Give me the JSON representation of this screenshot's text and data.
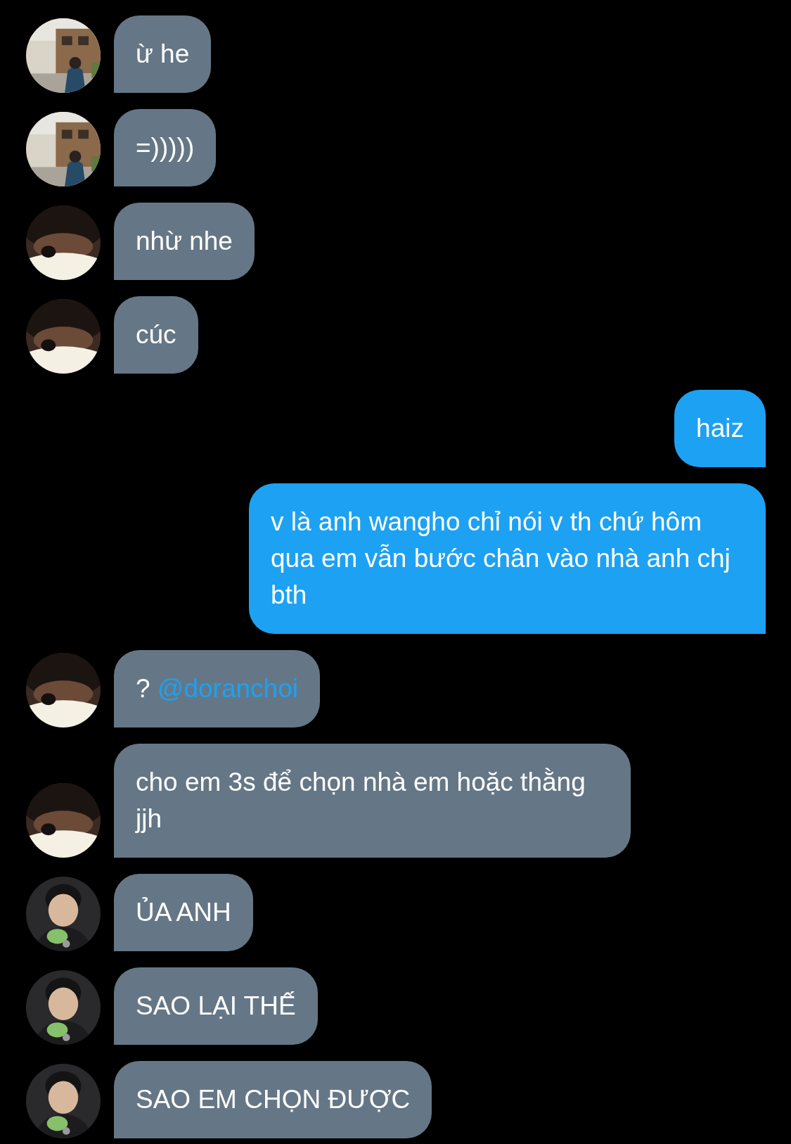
{
  "messages": [
    {
      "kind": "incoming",
      "text": "ừ he"
    },
    {
      "kind": "incoming",
      "text": "=)))))"
    },
    {
      "kind": "incoming",
      "text": "nhừ nhe"
    },
    {
      "kind": "incoming",
      "text": "cúc"
    },
    {
      "kind": "outgoing",
      "text": "haiz"
    },
    {
      "kind": "outgoing",
      "text": "v là anh wangho chỉ nói v th chứ hôm qua em vẫn bước chân vào nhà anh chj bth"
    },
    {
      "kind": "incoming",
      "text": "?",
      "mention": "@doranchoi"
    },
    {
      "kind": "incoming",
      "text": "cho em 3s để chọn nhà em hoặc thằng jjh"
    },
    {
      "kind": "incoming",
      "text": "ỦA ANH"
    },
    {
      "kind": "incoming",
      "text": "SAO LẠI THẾ"
    },
    {
      "kind": "incoming",
      "text": "SAO EM CHỌN ĐƯỢC"
    }
  ]
}
